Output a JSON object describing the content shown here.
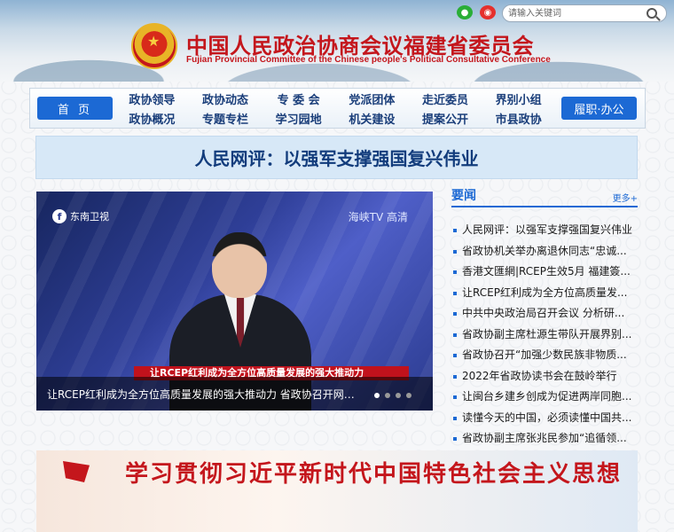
{
  "header": {
    "site_title": "中国人民政治协商会议福建省委员会",
    "site_subtitle": "Fujian Provincial Committee of the Chinese people's Political Consultative Conference",
    "search_placeholder": "请输入关键词",
    "social": [
      "wechat-icon",
      "weibo-icon"
    ]
  },
  "nav": {
    "home": "首 页",
    "duty": "履职·办公",
    "items": [
      "政协领导",
      "政协动态",
      "专 委 会",
      "党派团体",
      "走近委员",
      "界别小组",
      "政协概况",
      "专题专栏",
      "学习园地",
      "机关建设",
      "提案公开",
      "市县政协"
    ]
  },
  "headline": "人民网评：以强军支撑强国复兴伟业",
  "video": {
    "channel": "东南卫视",
    "tv_badge": "海峡TV  高清",
    "ticker": "让RCEP红利成为全方位高质量发展的强大推动力",
    "caption": "让RCEP红利成为全方位高质量发展的强大推动力 省政协召开网络..."
  },
  "news": {
    "title": "要闻",
    "more": "更多+",
    "items": [
      "人民网评：以强军支撑强国复兴伟业",
      "省政协机关举办离退休同志“忠诚...",
      "香港文匯網|RCEP生效5月 福建簽...",
      "让RCEP红利成为全方位高质量发...",
      "中共中央政治局召开会议 分析研...",
      "省政协副主席杜源生带队开展界别...",
      "省政协召开“加强少数民族非物质...",
      "2022年省政协读书会在鼓岭举行",
      "让闽台乡建乡创成为促进两岸同胞...",
      "读懂今天的中国，必须读懂中国共...",
      "省政协副主席张兆民参加“追循领..."
    ]
  },
  "banner": {
    "text": "学习贯彻习近平新时代中国特色社会主义思想"
  },
  "colors": {
    "brand_red": "#c4161c",
    "nav_blue": "#1c69d4",
    "nav_text": "#1a3e7a",
    "headline_bg": "#d7e8f7"
  }
}
